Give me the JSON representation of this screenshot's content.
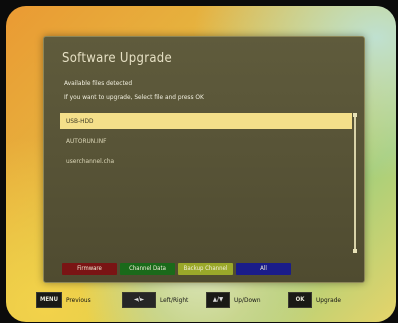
{
  "window": {
    "title": "Software Upgrade"
  },
  "instructions": {
    "line1": "Available files detected",
    "line2": "If you want to upgrade, Select file and press OK"
  },
  "files": [
    {
      "name": "USB-HDD",
      "selected": true
    },
    {
      "name": "AUTORUN.INF",
      "selected": false
    },
    {
      "name": "userchannel.cha",
      "selected": false
    }
  ],
  "color_buttons": [
    {
      "label": "Firmware",
      "color": "#7a1414"
    },
    {
      "label": "Channel Data",
      "color": "#1a6a1a"
    },
    {
      "label": "Backup Channel",
      "color": "#9aa82a"
    },
    {
      "label": "All",
      "color": "#1a1c8a"
    }
  ],
  "footer": {
    "menu_key": "MENU",
    "menu_label": "Previous",
    "leftright_key": "◄/►",
    "leftright_label": "Left/Right",
    "updown_key": "▲/▼",
    "updown_label": "Up/Down",
    "ok_key": "OK",
    "ok_label": "Upgrade"
  }
}
